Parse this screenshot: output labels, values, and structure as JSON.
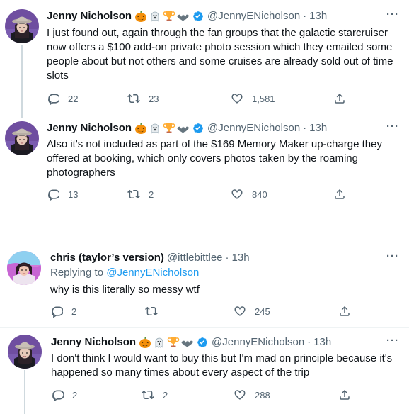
{
  "tweets": [
    {
      "name": "Jenny Nicholson",
      "handle": "@JennyENicholson",
      "time": "13h",
      "text": "I just found out, again through the fan groups that the galactic starcruiser now offers a $100 add-on private photo session which they emailed some people about but not others and some cruises are already sold out of time slots",
      "replies": "22",
      "retweets": "23",
      "likes": "1,581"
    },
    {
      "name": "Jenny Nicholson",
      "handle": "@JennyENicholson",
      "time": "13h",
      "text": "Also it's not included as part of the $169 Memory Maker up-charge they offered at booking, which only covers photos taken by the roaming photographers",
      "replies": "13",
      "retweets": "2",
      "likes": "840"
    },
    {
      "name": "chris (taylor’s version)",
      "handle": "@ittlebittlee",
      "time": "13h",
      "reply_label": "Replying to",
      "reply_to": "@JennyENicholson",
      "text": "why is this literally so messy wtf",
      "replies": "2",
      "retweets": "",
      "likes": "245"
    },
    {
      "name": "Jenny Nicholson",
      "handle": "@JennyENicholson",
      "time": "13h",
      "text": "I don't think I would want to buy this but I'm mad on principle because it's happened so many times about every aspect of the trip",
      "replies": "2",
      "retweets": "2",
      "likes": "288"
    }
  ],
  "separator": "·",
  "more_label": "···",
  "icons": {
    "name_emojis": [
      "jack-o-lantern-icon",
      "ghost-icon",
      "trophy-icon",
      "bat-icon"
    ],
    "verified": "verified-badge-icon",
    "actions": [
      "reply-icon",
      "retweet-icon",
      "like-icon",
      "share-icon"
    ]
  },
  "colors": {
    "text": "#0f1419",
    "secondary": "#536471",
    "link": "#1d9bf0",
    "thread_line": "#cfd9de"
  }
}
